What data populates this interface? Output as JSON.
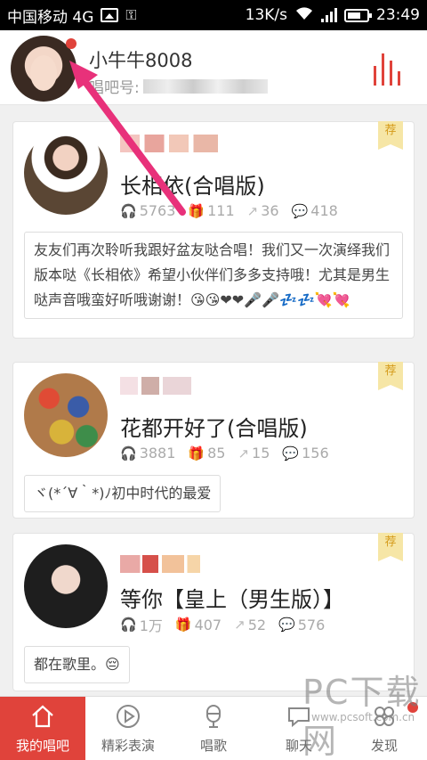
{
  "status_bar": {
    "carrier": "中国移动 4G",
    "speed": "13K/s",
    "time": "23:49"
  },
  "header": {
    "username": "小牛牛8008",
    "id_label": "唱吧号:"
  },
  "cards": [
    {
      "badge": "荐",
      "title": "长相依(合唱版)",
      "stats": {
        "listens": "5763",
        "gifts": "111",
        "shares": "36",
        "comments": "418"
      },
      "comment": "友友们再次聆听我跟好盆友哒合唱！我们又一次演绎我们版本哒《长相依》希望小伙伴们多多支持哦！尤其是男生哒声音哦蛮好听哦谢谢！😘😘❤❤🎤🎤💤💤💘💘"
    },
    {
      "badge": "荐",
      "title": "花都开好了(合唱版)",
      "stats": {
        "listens": "3881",
        "gifts": "85",
        "shares": "15",
        "comments": "156"
      },
      "comment": "ヾ(*´∀｀*)ﾉ初中时代的最爱"
    },
    {
      "badge": "荐",
      "title": "等你【皇上（男生版）】",
      "stats": {
        "listens": "1万",
        "gifts": "407",
        "shares": "52",
        "comments": "576"
      },
      "comment": "都在歌里。😔"
    }
  ],
  "tabs": [
    {
      "label": "我的唱吧",
      "icon": "home-icon",
      "active": true
    },
    {
      "label": "精彩表演",
      "icon": "play-icon",
      "active": false
    },
    {
      "label": "唱歌",
      "icon": "microphone-icon",
      "active": false
    },
    {
      "label": "聊天",
      "icon": "chat-icon",
      "active": false
    },
    {
      "label": "发现",
      "icon": "discover-icon",
      "active": false
    }
  ],
  "watermark": {
    "brand": "PC下载网",
    "url": "www.pcsoft.com.cn"
  },
  "colors": {
    "accent": "#e0433b",
    "badge_bg": "#f6e6a6",
    "arrow": "#e8317a"
  }
}
